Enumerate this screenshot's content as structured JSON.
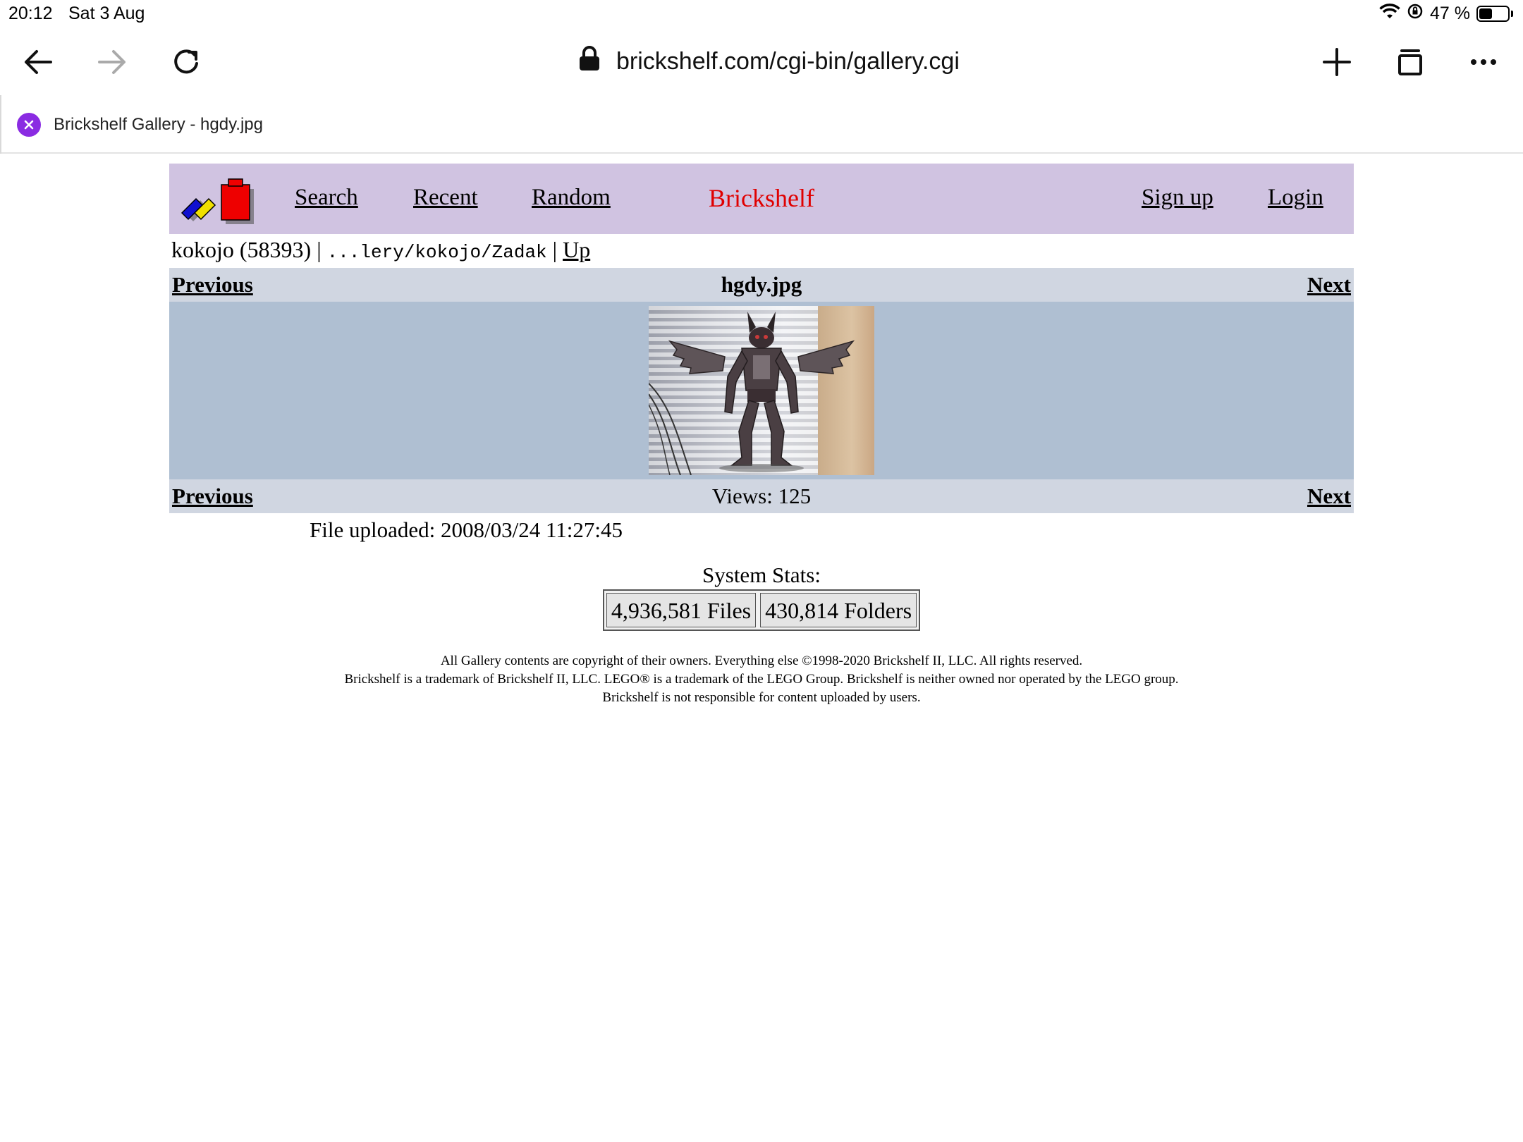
{
  "status_bar": {
    "time": "20:12",
    "date": "Sat 3 Aug",
    "battery": "47 %",
    "battery_level": 0.47
  },
  "browser": {
    "url": "brickshelf.com/cgi-bin/gallery.cgi",
    "tab_title": "Brickshelf Gallery - hgdy.jpg",
    "icons": {
      "back": "back-arrow-icon",
      "forward": "forward-arrow-icon",
      "reload": "reload-icon",
      "lock": "lock-icon",
      "new_tab": "plus-icon",
      "tabs": "tabs-icon",
      "menu": "more-icon"
    }
  },
  "site": {
    "nav": {
      "search": "Search",
      "recent": "Recent",
      "random": "Random",
      "brand": "Brickshelf",
      "signup": "Sign up",
      "login": "Login"
    },
    "breadcrumb": {
      "user": "kokojo (58393) |",
      "path": "...lery/kokojo/Zadak",
      "separator": "|",
      "up": "Up"
    },
    "viewer": {
      "previous": "Previous",
      "next": "Next",
      "filename": "hgdy.jpg",
      "views": "Views: 125"
    },
    "uploaded": "File uploaded: 2008/03/24 11:27:45",
    "stats": {
      "title": "System Stats:",
      "files": "4,936,581 Files",
      "folders": "430,814 Folders"
    },
    "footer": {
      "line1": "All Gallery contents are copyright of their owners. Everything else ©1998-2020 Brickshelf II, LLC. All rights reserved.",
      "line2": "Brickshelf is a trademark of Brickshelf II, LLC. LEGO® is a trademark of the LEGO Group. Brickshelf is neither owned nor operated by the LEGO group.",
      "line3": "Brickshelf is not responsible for content uploaded by users."
    }
  }
}
